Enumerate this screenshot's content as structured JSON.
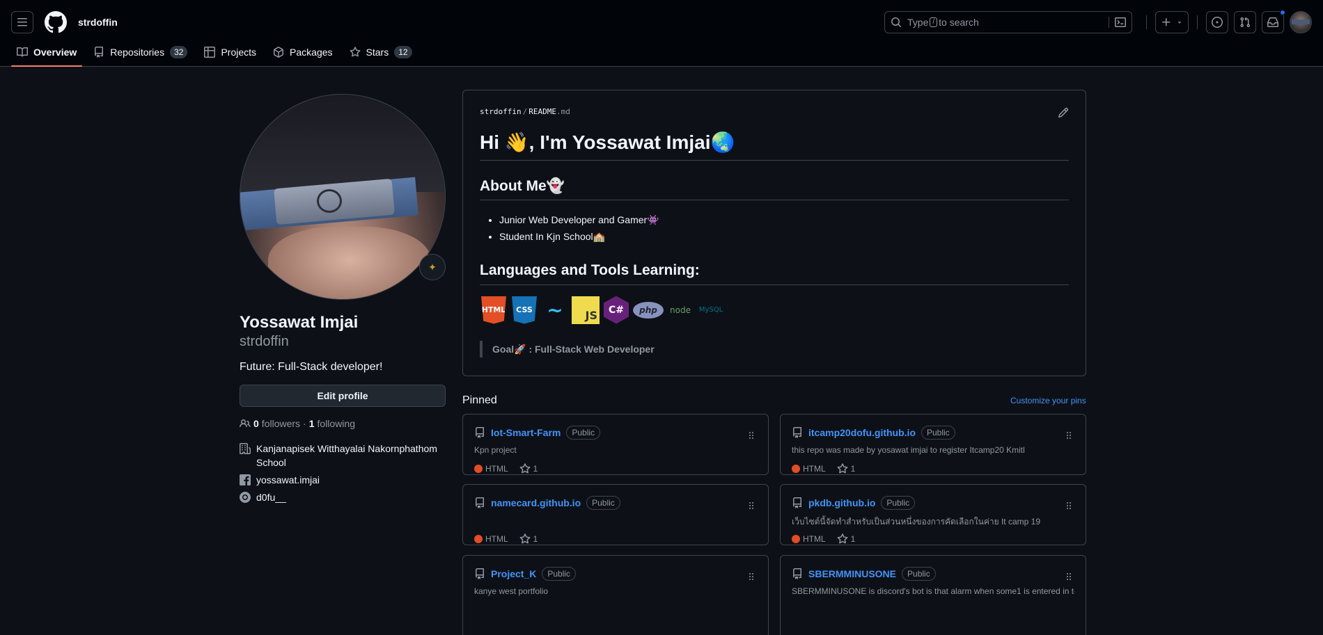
{
  "header": {
    "username": "strdoffin",
    "search": {
      "before": "Type",
      "key": "/",
      "after": "to search"
    }
  },
  "tabs": [
    {
      "label": "Overview"
    },
    {
      "label": "Repositories",
      "count": "32"
    },
    {
      "label": "Projects"
    },
    {
      "label": "Packages"
    },
    {
      "label": "Stars",
      "count": "12"
    }
  ],
  "profile": {
    "name": "Yossawat Imjai",
    "login": "strdoffin",
    "bio": "Future: Full-Stack developer!",
    "edit_label": "Edit profile",
    "followers_count": "0",
    "followers_label": "followers",
    "separator": "·",
    "following_count": "1",
    "following_label": "following",
    "organization_line1": "Kanjanapisek Witthayalai Nakornphathom",
    "organization_line2": "School",
    "facebook": "yossawat.imjai",
    "instagram": "d0fu__"
  },
  "readme": {
    "owner": "strdoffin",
    "slash": "/",
    "file": "README",
    "ext": ".md",
    "title": "Hi 👋, I'm Yossawat Imjai🌏",
    "about_heading": "About Me👻",
    "about_items": [
      "Junior Web Developer and Gamer👾",
      "Student In Kjn School🏫"
    ],
    "tools_heading": "Languages and Tools Learning:",
    "tools": [
      "HTML",
      "CSS",
      "~",
      "JS",
      "C#",
      "php",
      "node",
      "MySQL"
    ],
    "goal": "Goal🚀 : Full-Stack Web Developer"
  },
  "pinned": {
    "title": "Pinned",
    "customize": "Customize your pins",
    "items": [
      {
        "name": "Iot-Smart-Farm",
        "visibility": "Public",
        "description": "Kpn project",
        "language": "HTML",
        "stars": "1"
      },
      {
        "name": "itcamp20dofu.github.io",
        "visibility": "Public",
        "description": "this repo was made by yosawat imjai to register Itcamp20 Kmitl",
        "language": "HTML",
        "stars": "1"
      },
      {
        "name": "namecard.github.io",
        "visibility": "Public",
        "description": "",
        "language": "HTML",
        "stars": "1"
      },
      {
        "name": "pkdb.github.io",
        "visibility": "Public",
        "description": "เว็บไซต์นี้จัดทำสำหรับเป็นส่วนหนึ่งของการคัดเลือกในค่าย It camp 19",
        "language": "HTML",
        "stars": "1"
      },
      {
        "name": "Project_K",
        "visibility": "Public",
        "description": "kanye west portfolio"
      },
      {
        "name": "SBERMMINUSONE",
        "visibility": "Public",
        "description": "SBERMMINUSONE is discord's bot is that alarm when some1 is entered in to"
      }
    ]
  },
  "colors": {
    "accent": "#4493f8",
    "tab_underline": "#f78166",
    "html_lang": "#e34c26",
    "bg": "#0d1117"
  }
}
